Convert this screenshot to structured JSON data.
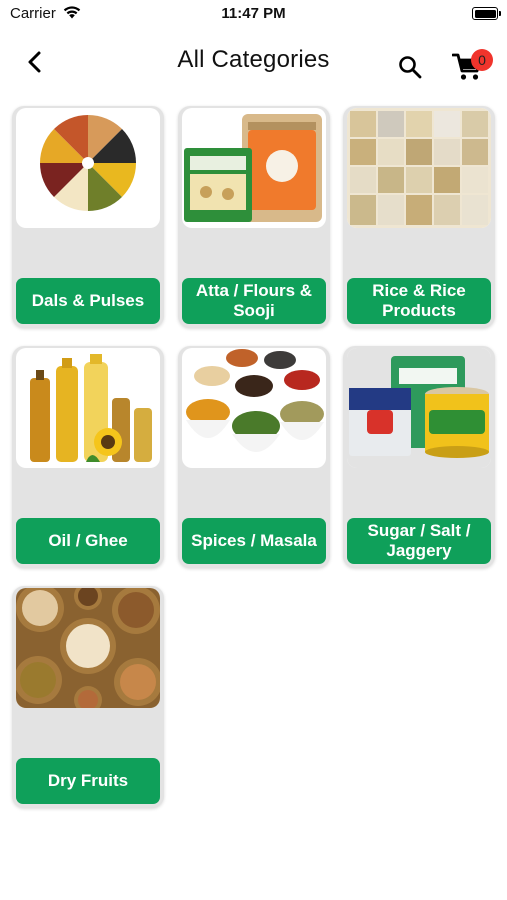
{
  "status_bar": {
    "carrier": "Carrier",
    "time": "11:47 PM"
  },
  "header": {
    "title": "All Categories",
    "back_icon": "chevron-left-icon",
    "search_icon": "search-icon",
    "cart_icon": "cart-icon",
    "cart_count": "0"
  },
  "colors": {
    "accent_green": "#0fa05a",
    "badge_red": "#f0342c",
    "card_bg": "#e3e3e3"
  },
  "categories": [
    {
      "label": "Dals & Pulses",
      "image": "dals-pulses-image"
    },
    {
      "label": "Atta / Flours & Sooji",
      "image": "atta-flours-image"
    },
    {
      "label": "Rice & Rice Products",
      "image": "rice-products-image"
    },
    {
      "label": "Oil / Ghee",
      "image": "oil-ghee-image"
    },
    {
      "label": "Spices / Masala",
      "image": "spices-masala-image"
    },
    {
      "label": "Sugar / Salt / Jaggery",
      "image": "sugar-salt-jaggery-image"
    },
    {
      "label": "Dry Fruits",
      "image": "dry-fruits-image"
    }
  ]
}
